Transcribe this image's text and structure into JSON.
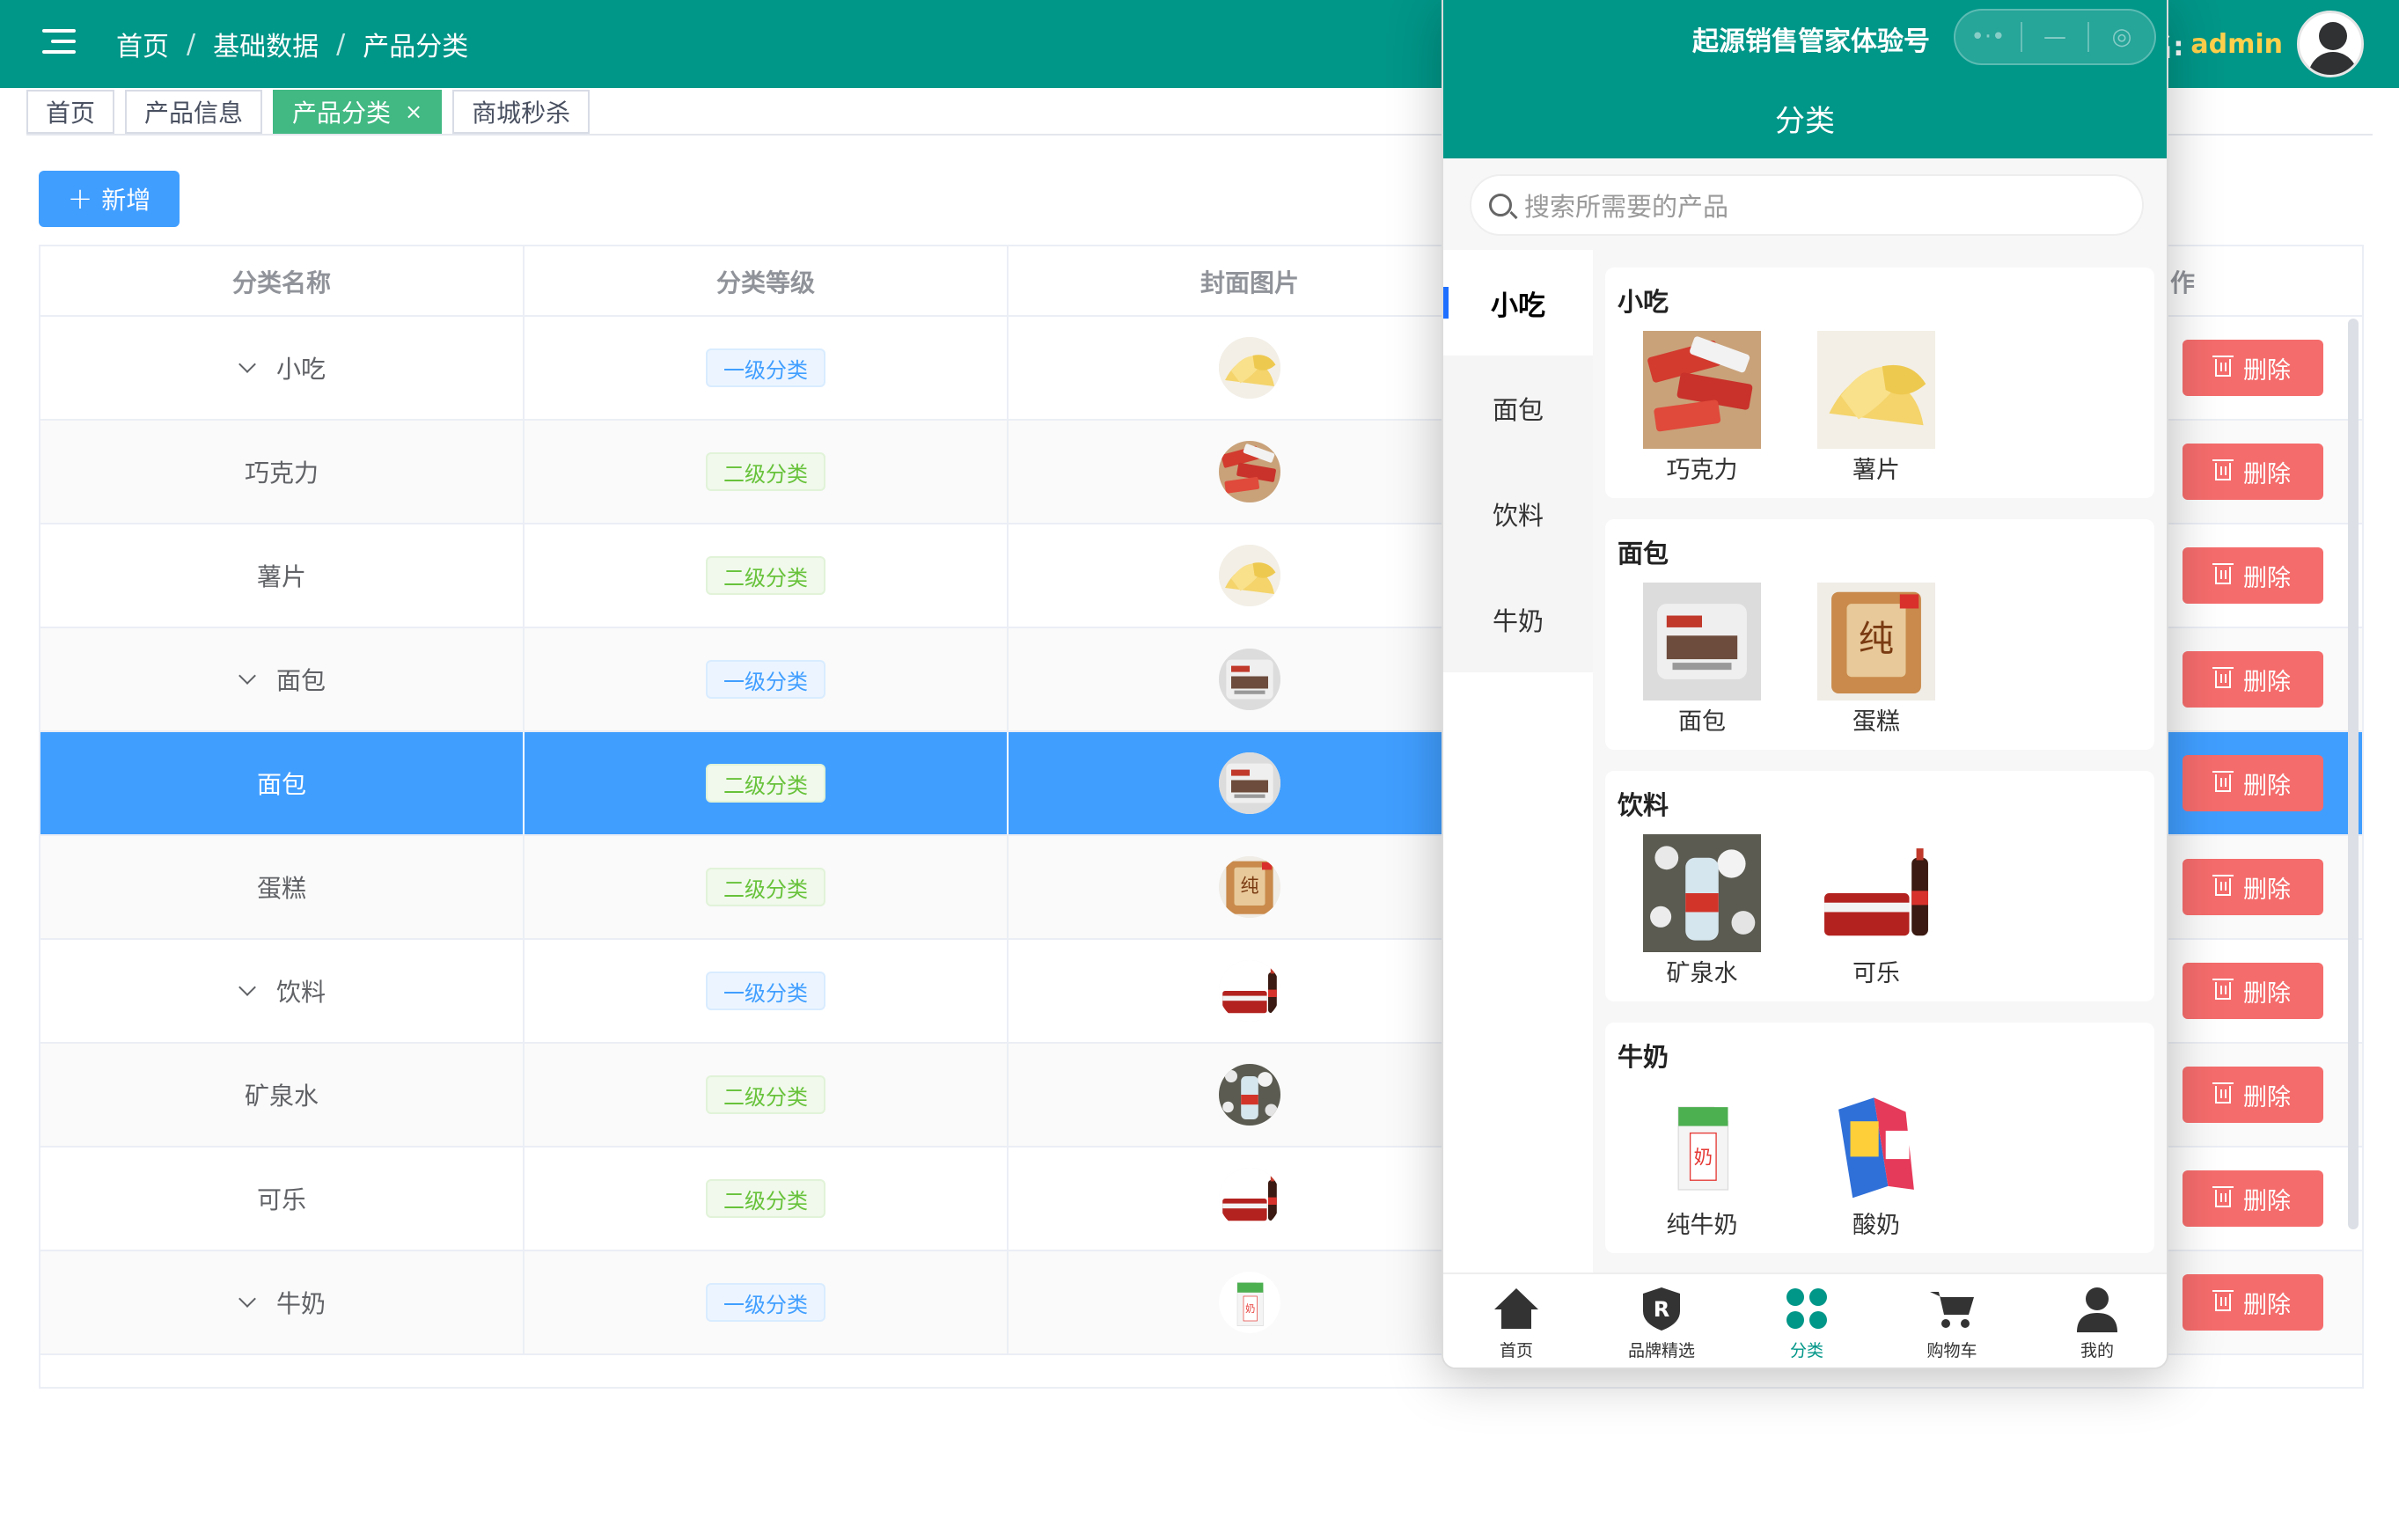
{
  "breadcrumb": [
    "首页",
    "基础数据",
    "产品分类"
  ],
  "user": {
    "label": "名:",
    "name": "admin"
  },
  "tabs": [
    {
      "label": "首页",
      "active": false
    },
    {
      "label": "产品信息",
      "active": false
    },
    {
      "label": "产品分类",
      "active": true,
      "closable": true
    },
    {
      "label": "商城秒杀",
      "active": false
    }
  ],
  "add_button": "新增",
  "table": {
    "headers": [
      "分类名称",
      "分类等级",
      "封面图片",
      "作"
    ],
    "delete_label": "删除",
    "rows": [
      {
        "name": "小吃",
        "level": "一级分类",
        "level_type": "l1",
        "top": true,
        "image": "chips"
      },
      {
        "name": "巧克力",
        "level": "二级分类",
        "level_type": "l2",
        "top": false,
        "image": "chocolate"
      },
      {
        "name": "薯片",
        "level": "二级分类",
        "level_type": "l2",
        "top": false,
        "image": "chips"
      },
      {
        "name": "面包",
        "level": "一级分类",
        "level_type": "l1",
        "top": true,
        "image": "bread"
      },
      {
        "name": "面包",
        "level": "二级分类",
        "level_type": "l2",
        "top": false,
        "image": "bread",
        "selected": true
      },
      {
        "name": "蛋糕",
        "level": "二级分类",
        "level_type": "l2",
        "top": false,
        "image": "cake"
      },
      {
        "name": "饮料",
        "level": "一级分类",
        "level_type": "l1",
        "top": true,
        "image": "cola"
      },
      {
        "name": "矿泉水",
        "level": "二级分类",
        "level_type": "l2",
        "top": false,
        "image": "water"
      },
      {
        "name": "可乐",
        "level": "二级分类",
        "level_type": "l2",
        "top": false,
        "image": "cola"
      },
      {
        "name": "牛奶",
        "level": "一级分类",
        "level_type": "l1",
        "top": true,
        "image": "milk"
      }
    ]
  },
  "phone": {
    "app_name": "起源销售管家体验号",
    "capsule": [
      "•·•",
      "—",
      "◎"
    ],
    "title": "分类",
    "search_placeholder": "搜索所需要的产品",
    "sidebar": [
      {
        "label": "小吃",
        "active": true
      },
      {
        "label": "面包",
        "active": false
      },
      {
        "label": "饮料",
        "active": false
      },
      {
        "label": "牛奶",
        "active": false
      }
    ],
    "groups": [
      {
        "title": "小吃",
        "items": [
          {
            "label": "巧克力",
            "image": "chocolate"
          },
          {
            "label": "薯片",
            "image": "chips"
          }
        ]
      },
      {
        "title": "面包",
        "items": [
          {
            "label": "面包",
            "image": "bread"
          },
          {
            "label": "蛋糕",
            "image": "cake"
          }
        ]
      },
      {
        "title": "饮料",
        "items": [
          {
            "label": "矿泉水",
            "image": "water"
          },
          {
            "label": "可乐",
            "image": "cola"
          }
        ]
      },
      {
        "title": "牛奶",
        "items": [
          {
            "label": "纯牛奶",
            "image": "milk"
          },
          {
            "label": "酸奶",
            "image": "yogurt"
          }
        ]
      }
    ],
    "nav": [
      {
        "label": "首页",
        "icon": "home-icon",
        "active": false
      },
      {
        "label": "品牌精选",
        "icon": "brand-icon",
        "active": false
      },
      {
        "label": "分类",
        "icon": "category-icon",
        "active": true
      },
      {
        "label": "购物车",
        "icon": "cart-icon",
        "active": false
      },
      {
        "label": "我的",
        "icon": "user-icon",
        "active": false
      }
    ]
  },
  "colors": {
    "primary": "#009688",
    "blue": "#409eff",
    "danger": "#f56c6c",
    "success": "#67c23a",
    "tab_active": "#42b983"
  }
}
